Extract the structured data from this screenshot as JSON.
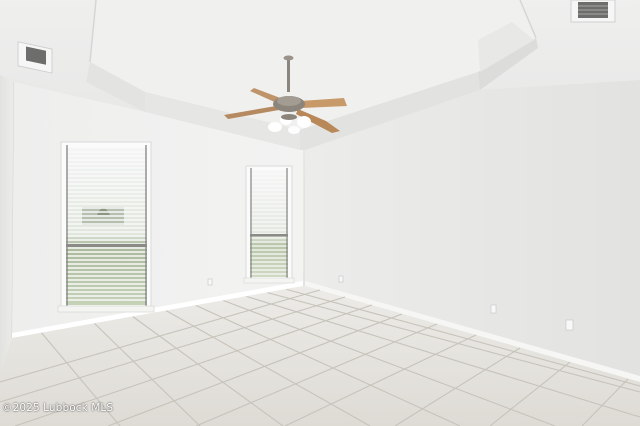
{
  "photo": {
    "subject": "empty-room-interior",
    "colors": {
      "ceiling": "#ececeb",
      "left_wall": "#ececea",
      "back_wall": "#f1f1f0",
      "right_wall": "#e6e6e4",
      "floor_tile": "#e4e2dd",
      "grout": "#c9c6bf",
      "fan_blade": "#c89a6a",
      "fan_metal": "#8c857c"
    }
  },
  "watermark": {
    "text": "©2025 Lubbock MLS"
  }
}
